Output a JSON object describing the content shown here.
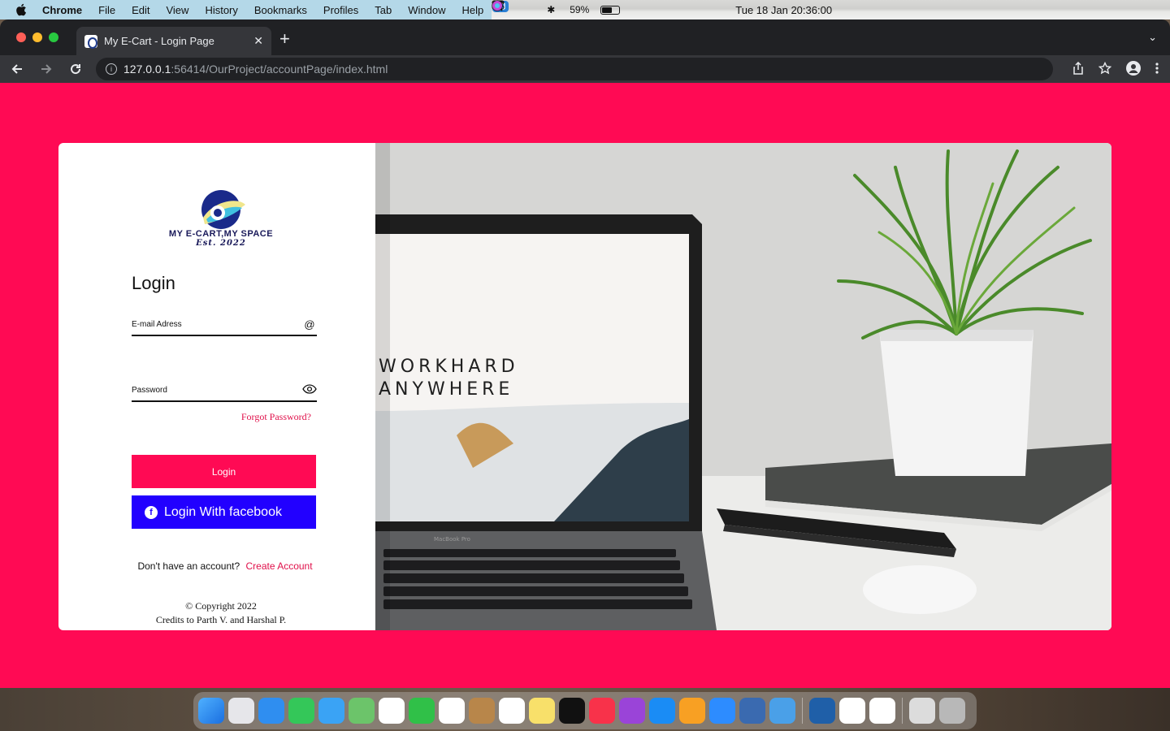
{
  "menubar": {
    "app_name": "Chrome",
    "items": [
      "File",
      "Edit",
      "View",
      "History",
      "Bookmarks",
      "Profiles",
      "Tab",
      "Window",
      "Help"
    ],
    "battery": "59%",
    "battery_level": 0.59,
    "datetime": "Tue 18 Jan  20:36:00"
  },
  "browser": {
    "tab_title": "My E-Cart - Login Page",
    "url_host": "127.0.0.1",
    "url_path": ":56414/OurProject/accountPage/index.html"
  },
  "login": {
    "logo_text": "MY E-CART,MY SPACE",
    "logo_sub": "Est. 2022",
    "title": "Login",
    "email_placeholder": "E-mail Adress",
    "email_icon": "@",
    "password_placeholder": "Password",
    "forgot": "Forgot Password?",
    "login_button": "Login",
    "facebook_button": "Login With facebook",
    "signup_text": "Don't have an account?",
    "signup_link": "Create Account",
    "copyright": "© Copyright 2022",
    "credits": "Credits to Parth V. and Harshal P."
  },
  "photo": {
    "screen_line1": "WORKHARD",
    "screen_line2": "ANYWHERE",
    "laptop_label": "MacBook Pro"
  },
  "colors": {
    "brand": "#ff0a54",
    "facebook": "#2200ff"
  }
}
